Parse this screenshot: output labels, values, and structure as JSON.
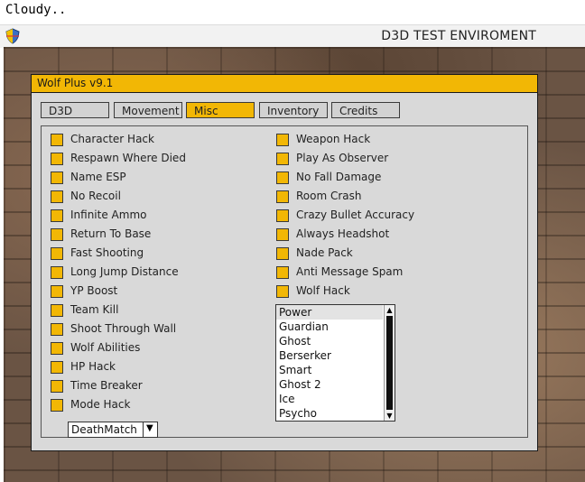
{
  "caption": "Cloudy..",
  "window": {
    "title": "D3D TEST ENVIROMENT"
  },
  "menu": {
    "title": "Wolf Plus v9.1",
    "tabs": [
      "D3D",
      "Movement",
      "Misc",
      "Inventory",
      "Credits"
    ],
    "active_tab": "Misc",
    "left_options": [
      "Character Hack",
      "Respawn Where Died",
      "Name ESP",
      "No Recoil",
      "Infinite Ammo",
      "Return To Base",
      "Fast Shooting",
      "Long Jump Distance",
      "YP Boost",
      "Team Kill",
      "Shoot Through Wall",
      "Wolf Abilities",
      "HP Hack",
      "Time Breaker",
      "Mode Hack"
    ],
    "right_options": [
      "Weapon Hack",
      "Play As Observer",
      "No Fall Damage",
      "Room Crash",
      "Crazy Bullet Accuracy",
      "Always Headshot",
      "Nade Pack",
      "Anti Message Spam",
      "Wolf Hack"
    ],
    "mode_dropdown": {
      "value": "DeathMatch"
    },
    "wolf_list": {
      "items": [
        "Power",
        "Guardian",
        "Ghost",
        "Berserker",
        "Smart",
        "Ghost 2",
        "Ice",
        "Psycho"
      ],
      "selected": "Power"
    }
  },
  "colors": {
    "accent": "#f2b705",
    "panel": "#d9d9d9"
  },
  "icons": {
    "window_icon": "shield-icon",
    "dropdown_arrow": "chevron-down-icon"
  }
}
